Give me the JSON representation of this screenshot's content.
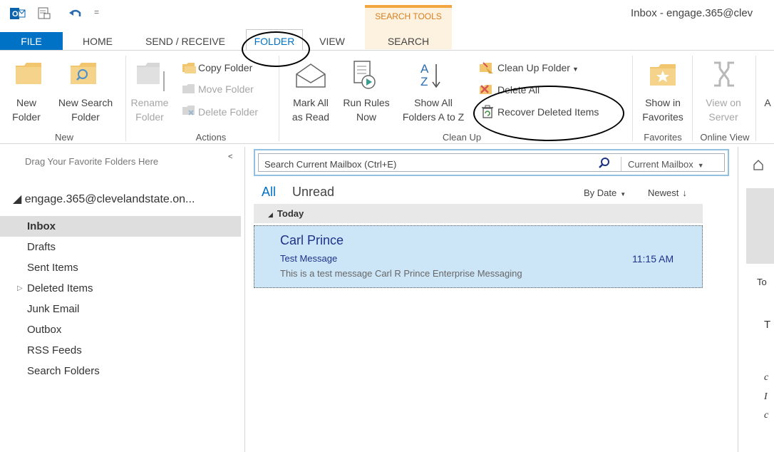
{
  "window": {
    "title": "Inbox - engage.365@clev"
  },
  "quick_access": {
    "app_icon": "outlook-icon",
    "save_icon": "send-receive-icon",
    "undo_icon": "undo-icon",
    "customize_icon": "customize-qat-icon",
    "customize_glyph": "="
  },
  "context_tab": {
    "label": "SEARCH TOOLS",
    "color": "#f2a541"
  },
  "tabs": [
    {
      "label": "FILE"
    },
    {
      "label": "HOME"
    },
    {
      "label": "SEND / RECEIVE"
    },
    {
      "label": "FOLDER"
    },
    {
      "label": "VIEW"
    },
    {
      "label": "SEARCH"
    }
  ],
  "ribbon": {
    "new_group": {
      "label": "New",
      "new_folder": [
        "New",
        "Folder"
      ],
      "new_search_folder": [
        "New Search",
        "Folder"
      ]
    },
    "actions_group": {
      "label": "Actions",
      "rename_folder": [
        "Rename",
        "Folder"
      ],
      "copy_folder": "Copy Folder",
      "move_folder": "Move Folder",
      "delete_folder": "Delete Folder"
    },
    "cleanup_group": {
      "label": "Clean Up",
      "mark_all_read": [
        "Mark All",
        "as Read"
      ],
      "run_rules_now": [
        "Run Rules",
        "Now"
      ],
      "show_all_folders": [
        "Show All",
        "Folders A to Z"
      ],
      "clean_up_folder": "Clean Up Folder",
      "delete_all": "Delete All",
      "recover_deleted": "Recover Deleted Items"
    },
    "favorites_group": {
      "label": "Favorites",
      "show_in_favorites": [
        "Show in",
        "Favorites"
      ]
    },
    "online_view_group": {
      "label": "Online View",
      "view_on_server": [
        "View on",
        "Server"
      ]
    },
    "overflow_label": "A"
  },
  "folder_pane": {
    "drag_hint": "Drag Your Favorite Folders Here",
    "collapse_glyph": "<",
    "account": "◢ engage.365@clevelandstate.on...",
    "folders": [
      {
        "label": "Inbox"
      },
      {
        "label": "Drafts"
      },
      {
        "label": "Sent Items"
      },
      {
        "label": "Deleted Items"
      },
      {
        "label": "Junk Email"
      },
      {
        "label": "Outbox"
      },
      {
        "label": "RSS Feeds"
      },
      {
        "label": "Search Folders"
      }
    ]
  },
  "search": {
    "placeholder": "Search Current Mailbox (Ctrl+E)",
    "scope": "Current Mailbox"
  },
  "message_list": {
    "filter_all": "All",
    "filter_unread": "Unread",
    "sort_by": "By Date",
    "sort_order": "Newest",
    "group_header": "Today",
    "messages": [
      {
        "sender": "Carl Prince",
        "subject": "Test Message",
        "time": "11:15 AM",
        "preview": "This is a test message  Carl R Prince    Enterprise Messaging"
      }
    ]
  },
  "reading_pane": {
    "to_label": "To",
    "t_fragment": "T",
    "f1": "c",
    "f2": "I",
    "f3": "c"
  },
  "colors": {
    "accent": "#0072c6",
    "selection": "#cde6f7",
    "context_orange": "#f2a541"
  }
}
